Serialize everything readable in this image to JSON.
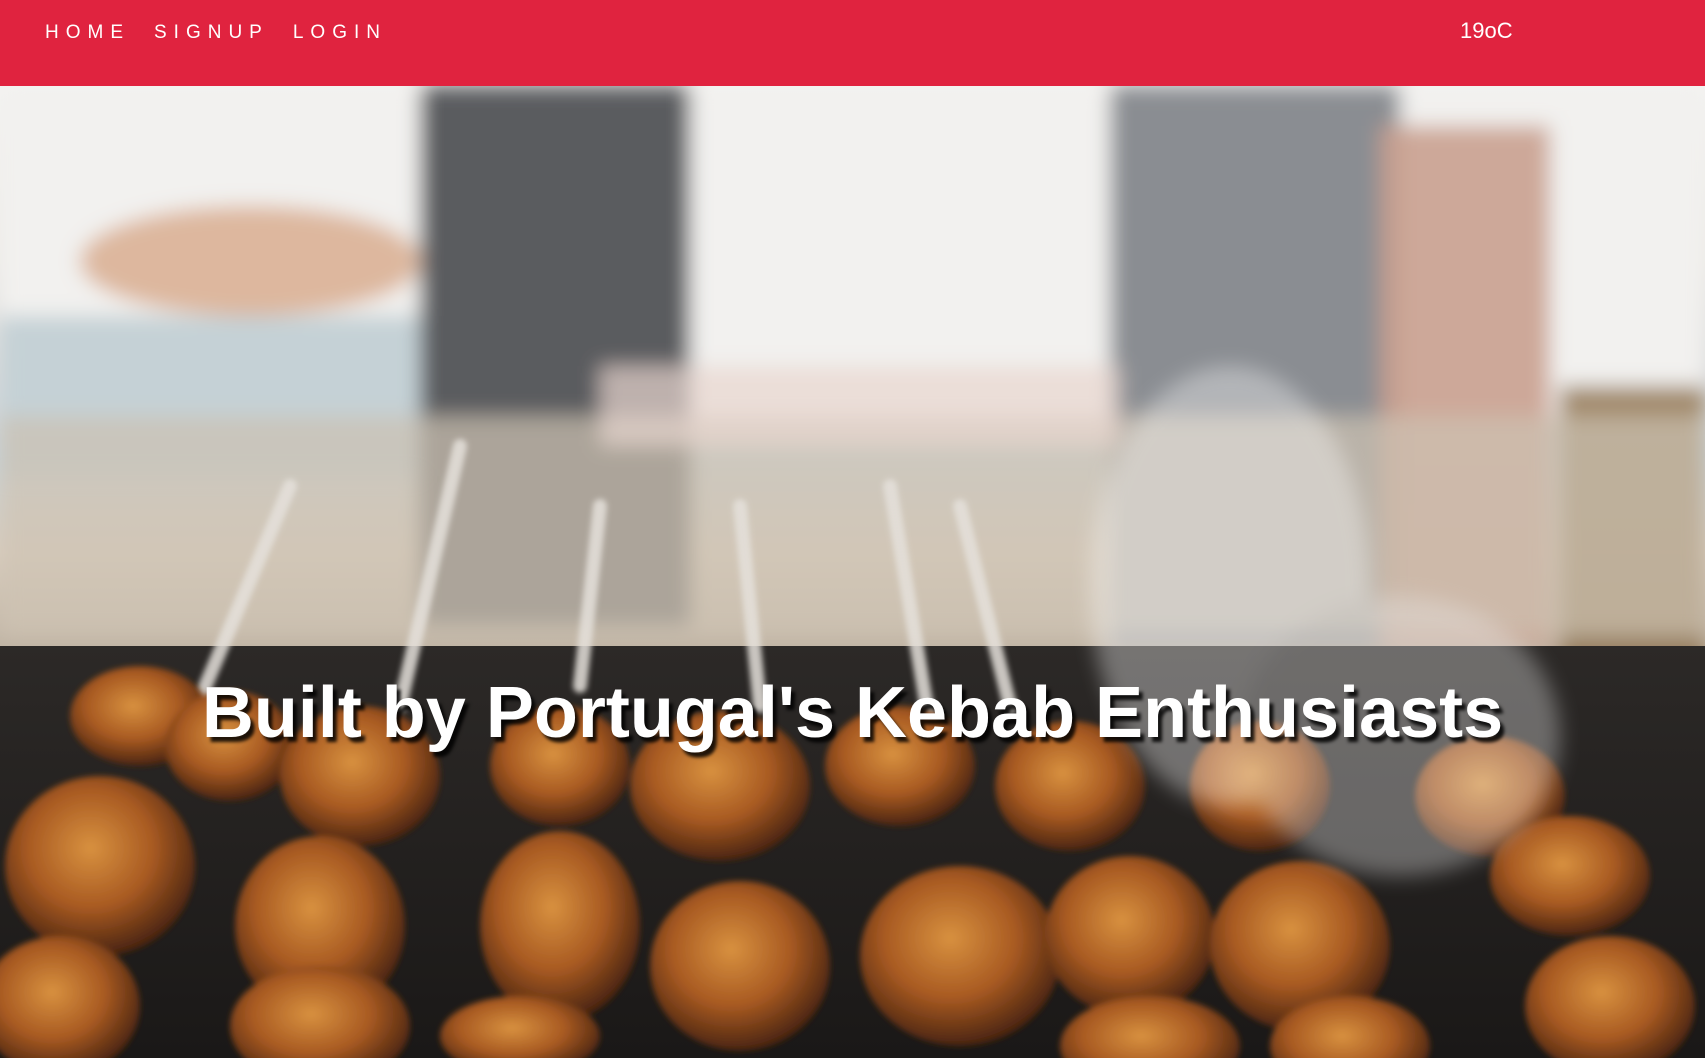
{
  "nav": {
    "items": [
      {
        "label": "HOME"
      },
      {
        "label": "SIGNUP"
      },
      {
        "label": "LOGIN"
      }
    ],
    "weather": "19oC",
    "color": "#e0233f"
  },
  "hero": {
    "title": "Built by Portugal's Kebab Enthusiasts",
    "background": "photo-grilled-kebab-skewers"
  }
}
